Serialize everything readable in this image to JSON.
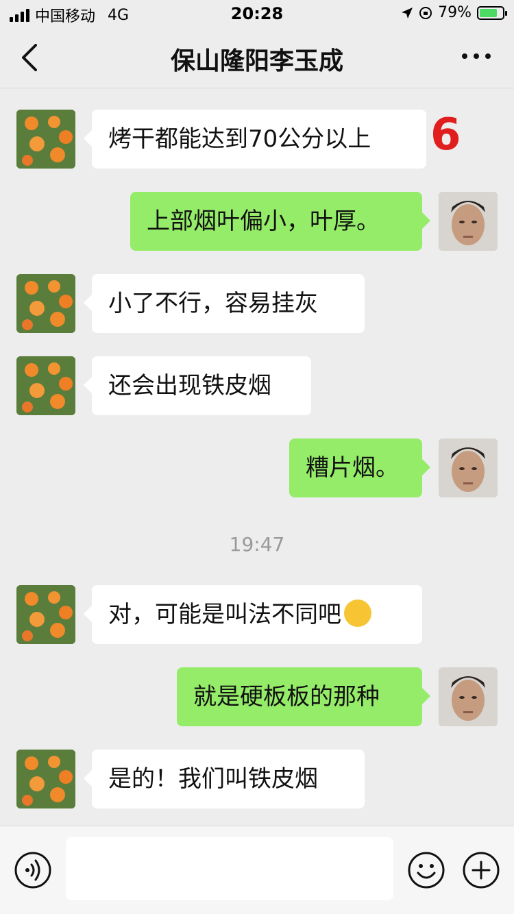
{
  "status": {
    "carrier": "中国移动",
    "network": "4G",
    "time": "20:28",
    "battery": "79%",
    "battery_level": 0.79
  },
  "header": {
    "title": "保山隆阳李玉成"
  },
  "annotation": "6",
  "messages": [
    {
      "side": "left",
      "text": "烤干都能达到70公分以上"
    },
    {
      "side": "right",
      "text": "上部烟叶偏小，叶厚。"
    },
    {
      "side": "left",
      "text": "小了不行，容易挂灰"
    },
    {
      "side": "left",
      "text": "还会出现铁皮烟"
    },
    {
      "side": "right",
      "text": "糟片烟。"
    },
    {
      "side": "left",
      "text": "对，可能是叫法不同吧"
    },
    {
      "side": "right",
      "text": "就是硬板板的那种"
    },
    {
      "side": "left",
      "text": "是的！我们叫铁皮烟"
    }
  ],
  "timestamp": "19:47",
  "colors": {
    "background": "#ededed",
    "bubble_self": "#95ec69",
    "bubble_other": "#ffffff",
    "annotation": "#e01e1e"
  }
}
